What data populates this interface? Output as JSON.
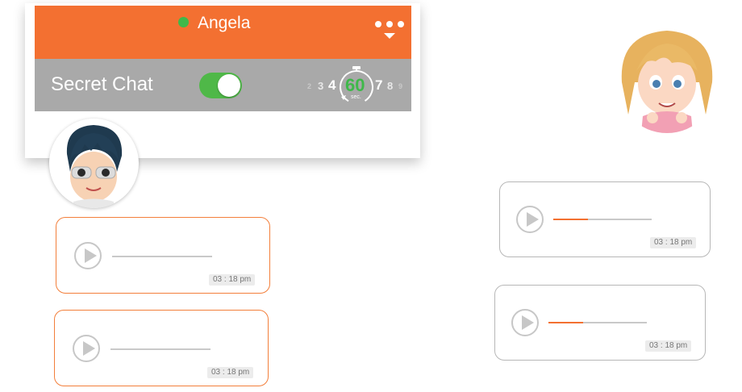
{
  "header": {
    "contact_name": "Angela",
    "status": "online",
    "menu_icon": "more-dots-icon"
  },
  "secret_chat": {
    "label": "Secret Chat",
    "enabled": true,
    "timer": {
      "left_numbers": [
        "2",
        "3",
        "4"
      ],
      "selected": "60",
      "right_numbers": [
        "7",
        "8",
        "9"
      ],
      "unit": "sec."
    }
  },
  "messages": [
    {
      "side": "sent",
      "time": "03 : 18 pm",
      "played": 0
    },
    {
      "side": "sent",
      "time": "03 : 18 pm",
      "played": 0
    },
    {
      "side": "received",
      "time": "03 : 18 pm",
      "played": 0.35
    },
    {
      "side": "received",
      "time": "03 : 18 pm",
      "played": 0.35
    }
  ],
  "colors": {
    "accent": "#f37031",
    "online": "#3fb84a",
    "toggle_on": "#4fb848",
    "bar_gray": "#a9a9a9",
    "bubble_border_gray": "#b7b7b7"
  }
}
